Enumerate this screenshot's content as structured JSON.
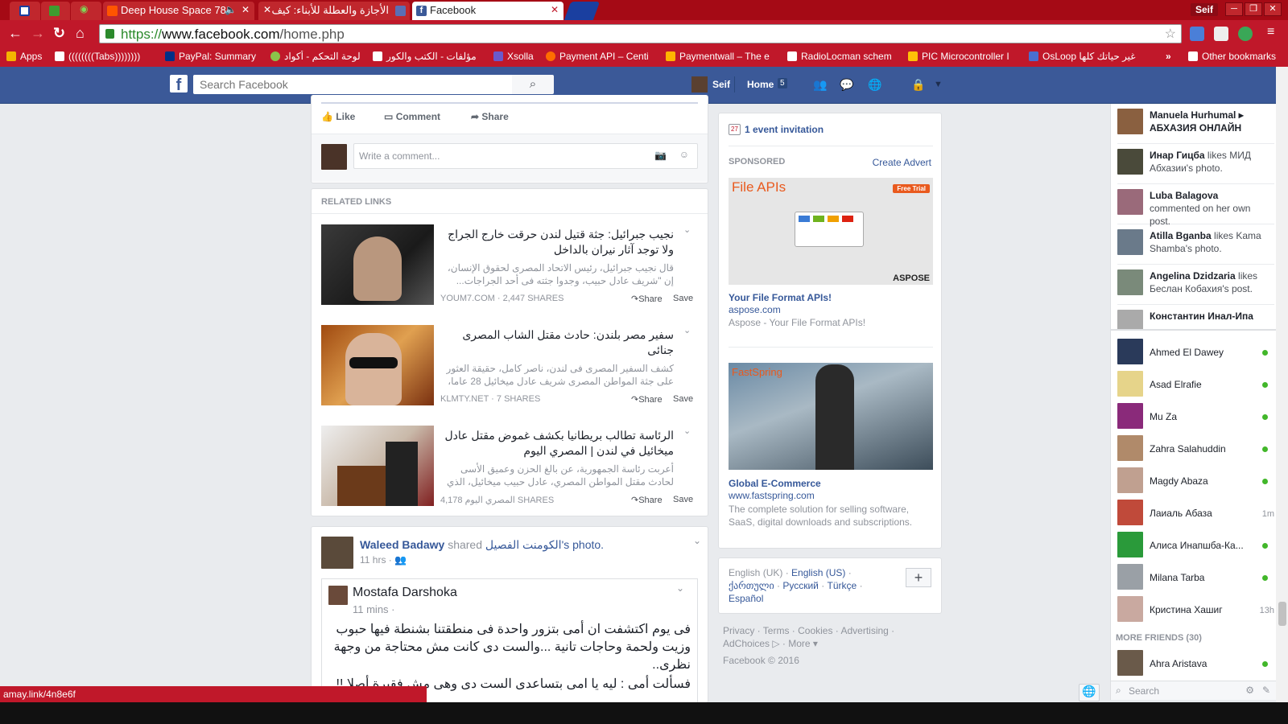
{
  "browser": {
    "tabs": [
      {
        "label": ""
      },
      {
        "label": ""
      },
      {
        "label": ""
      },
      {
        "label": "Deep House Space 78"
      },
      {
        "label": "الأجازة والعطلة للأبناء: كيف"
      },
      {
        "label": "Facebook"
      }
    ],
    "profile": "Seif",
    "url_scheme": "https://",
    "url_host": "www.facebook.com",
    "url_path": "/home.php",
    "bookmarks": [
      "Apps",
      "((((((((Tabs))))))))",
      "PayPal: Summary",
      "لوحة التحكم - أكواد",
      "مؤلفات - الكتب والكور",
      "Xsolla",
      "Payment API – Centi",
      "Paymentwall – The e",
      "RadioLocman schem",
      "PIC Microcontroller I",
      "OsLoop غير حياتك كلها",
      "»",
      "Other bookmarks"
    ]
  },
  "fb": {
    "search_placeholder": "Search Facebook",
    "user": "Seif",
    "home": "Home",
    "home_count": "5"
  },
  "post_actions": {
    "like": "Like",
    "comment": "Comment",
    "share": "Share"
  },
  "comment_placeholder": "Write a comment...",
  "related": {
    "header": "RELATED LINKS",
    "items": [
      {
        "title": "نجيب جبرائيل: جثة قتيل لندن حرقت خارج الجراج ولا توجد آثار نيران بالداخل",
        "desc": "قال نجيب جبرائيل، رئيس الاتحاد المصرى لحقوق الإنسان، إن \"شريف عادل حبيب، وجدوا جثته فى أحد الجراجات...",
        "source": "YOUM7.COM · 2,447 SHARES"
      },
      {
        "title": "سفير مصر بلندن: حادث مقتل الشاب المصرى جنائى",
        "desc": "كشف السفير المصرى فى لندن، ناصر كامل، حقيقة العثور على جثة المواطن المصرى شريف عادل ميخائيل 28 عاما،",
        "source": "KLMTY.NET · 7 SHARES"
      },
      {
        "title": "الرئاسة تطالب بريطانيا بكشف غموض مقتل عادل ميخائيل في لندن | المصري اليوم",
        "desc": "أعربت رئاسة الجمهورية، عن بالغ الحزن وعميق الأسى لحادث مقتل المواطن المصري، عادل حبيب ميخائيل، الذي",
        "source": "4,178 المصري اليوم SHARES"
      }
    ],
    "share": "Share",
    "save": "Save"
  },
  "post2": {
    "author": "Waleed Badawy",
    "shared": "shared",
    "page": "الكومنت الفصيل",
    "photo": "'s photo.",
    "time": "11 hrs ·",
    "inner_author": "Mostafa Darshoka",
    "inner_time": "11 mins ·",
    "inner_text_1": "فى يوم اكتشفت ان أمى بتزور واحدة فى منطقتنا بشنطة فيها حبوب وزيت ولحمة وحاجات تانية ...والست دى كانت مش محتاجة من وجهة نظرى..",
    "inner_text_2": "فسألت أمى : ليه يا امى بتساعدى الست دى وهى مش فقيرة أصلا !!"
  },
  "rightrail": {
    "event": "1 event invitation",
    "event_day": "27",
    "sponsored": "SPONSORED",
    "create_advert": "Create Advert",
    "ad1": {
      "banner": "File APIs",
      "badge": "Free Trial",
      "brand": "ASPOSE",
      "title": "Your File Format APIs!",
      "url": "aspose.com",
      "desc": "Aspose - Your File Format APIs!"
    },
    "ad2": {
      "brand": "FastSpring",
      "title": "Global E-Commerce",
      "url": "www.fastspring.com",
      "desc": "The complete solution for selling software, SaaS, digital downloads and subscriptions."
    },
    "languages": {
      "current": "English (UK) ·",
      "links": [
        "English (US)",
        "ქართული",
        "Русский",
        "Türkçe",
        "Español"
      ]
    },
    "footer": {
      "line1": "Privacy · Terms · Cookies · Advertising ·",
      "line2": "AdChoices ▷ · More ▾",
      "copyright": "Facebook © 2016"
    }
  },
  "ticker": [
    {
      "name": "Manuela Hurhumal",
      "text": " ▸ АБХАЗИЯ ОНЛАЙН",
      "bold_text": true
    },
    {
      "name": "Инар Гицба",
      "text": " likes МИД Абхазии's photo."
    },
    {
      "name": "Luba Balagova",
      "text": " commented on her own post."
    },
    {
      "name": "Atilla Bganba",
      "text": " likes Kama Shamba's photo."
    },
    {
      "name": "Angelina Dzidzaria",
      "text": " likes Беслан Кобахия's post."
    },
    {
      "name": "Константин Инал-Ипа",
      "text": ""
    }
  ],
  "chat": [
    {
      "name": "Ahmed El Dawey",
      "status": "online",
      "time": ""
    },
    {
      "name": "Asad Elrafie",
      "status": "online",
      "time": ""
    },
    {
      "name": "Mu Za",
      "status": "online",
      "time": ""
    },
    {
      "name": "Zahra Salahuddin",
      "status": "online",
      "time": ""
    },
    {
      "name": "Magdy Abaza",
      "status": "online",
      "time": ""
    },
    {
      "name": "Лаиаль Абаза",
      "status": "idle",
      "time": "1m"
    },
    {
      "name": "Алиса Инапшба-Ка...",
      "status": "online",
      "time": ""
    },
    {
      "name": "Milana Tarba",
      "status": "online",
      "time": ""
    },
    {
      "name": "Кристина Хашиг",
      "status": "idle",
      "time": "13h"
    }
  ],
  "more_friends": "MORE FRIENDS (30)",
  "more_friend": {
    "name": "Ahra Aristava"
  },
  "chat_search": "Search",
  "status_url": "amay.link/4n8e6f",
  "colors": {
    "chrome": "#c0182a",
    "fb_blue": "#3b5998",
    "online": "#42b72a"
  }
}
